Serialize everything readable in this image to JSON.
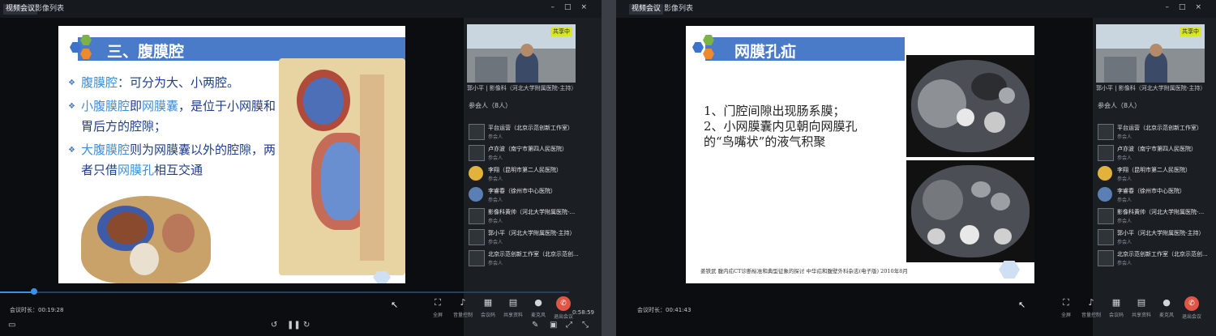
{
  "left_window": {
    "tabs": [
      "视频会议",
      "影像列表"
    ],
    "window_controls": [
      "–",
      "□",
      "×"
    ],
    "slide": {
      "title": "三、腹膜腔",
      "bullets": [
        [
          {
            "t": "腹膜腔",
            "hl": true
          },
          {
            "t": "：可分为大、小两腔。",
            "hl": false
          }
        ],
        [
          {
            "t": "小腹膜腔",
            "hl": true
          },
          {
            "t": "即",
            "hl": false
          },
          {
            "t": "网膜囊",
            "hl": true
          },
          {
            "t": "，是位于小网膜和胃后方的腔隙；",
            "hl": false
          }
        ],
        [
          {
            "t": "大腹膜腔",
            "hl": true
          },
          {
            "t": "则为网膜囊以外的腔隙，两者只借",
            "hl": false
          },
          {
            "t": "网膜孔",
            "hl": true
          },
          {
            "t": "相互交通",
            "hl": false
          }
        ]
      ]
    },
    "sidebar": {
      "share_badge": "共享中",
      "video_caption": "郭小平 | 影像科（河北大学附属医院-主持）",
      "participants_header": "参会人（8人）",
      "participants": [
        {
          "name": "平台运营（北京示范创新工作室）",
          "role": "参会人",
          "avatar": "generic"
        },
        {
          "name": "卢亦波（南宁市第四人民医院）",
          "role": "参会人",
          "avatar": "generic"
        },
        {
          "name": "李翔（昆明市第二人民医院）",
          "role": "参会人",
          "avatar": "cartoon"
        },
        {
          "name": "李睿春（徐州市中心医院）",
          "role": "参会人",
          "avatar": "photo"
        },
        {
          "name": "影像科黄帅（河北大学附属医院-...",
          "role": "参会人",
          "avatar": "generic"
        },
        {
          "name": "郭小平（河北大学附属医院-主持）",
          "role": "参会人",
          "avatar": "generic"
        },
        {
          "name": "北京示范创新工作室（北京示范创...",
          "role": "参会人",
          "avatar": "generic"
        }
      ]
    },
    "meeting_duration": "会议时长：00:19:28",
    "elapsed_time": "0:58:59",
    "progress": 0.06,
    "controls": [
      {
        "label": "全屏",
        "icon": "⛶"
      },
      {
        "label": "音量控制",
        "icon": "♪"
      },
      {
        "label": "会议码",
        "icon": "▦"
      },
      {
        "label": "共享资料",
        "icon": "▤"
      },
      {
        "label": "麦克风",
        "icon": "●"
      },
      {
        "label": "退出会议",
        "icon": "✆"
      }
    ]
  },
  "right_window": {
    "tabs": [
      "视频会议",
      "影像列表"
    ],
    "window_controls": [
      "–",
      "□",
      "×"
    ],
    "slide": {
      "title": "网膜孔疝",
      "points": [
        "1、门腔间隙出现肠系膜；",
        "2、小网膜囊内见朝向网膜孔",
        "的“鸟嘴状”的液气积聚"
      ],
      "citation": "姜铁武 腹内疝CT诊断标准和典型征象的探讨 中华疝和腹壁外科杂志(电子版) 2010年8月"
    },
    "sidebar": {
      "share_badge": "共享中",
      "video_caption": "郭小平 | 影像科（河北大学附属医院-主持）",
      "participants_header": "参会人（8人）",
      "participants": [
        {
          "name": "平台运营（北京示范创新工作室）",
          "role": "参会人",
          "avatar": "generic"
        },
        {
          "name": "卢亦波（南宁市第四人民医院）",
          "role": "参会人",
          "avatar": "generic"
        },
        {
          "name": "李翔（昆明市第二人民医院）",
          "role": "参会人",
          "avatar": "cartoon"
        },
        {
          "name": "李睿春（徐州市中心医院）",
          "role": "参会人",
          "avatar": "photo"
        },
        {
          "name": "影像科黄帅（河北大学附属医院-...",
          "role": "参会人",
          "avatar": "generic"
        },
        {
          "name": "郭小平（河北大学附属医院-主持）",
          "role": "参会人",
          "avatar": "generic"
        },
        {
          "name": "北京示范创新工作室（北京示范创...",
          "role": "参会人",
          "avatar": "generic"
        }
      ]
    },
    "meeting_duration": "会议时长：00:41:43",
    "controls": [
      {
        "label": "全屏",
        "icon": "⛶"
      },
      {
        "label": "音量控制",
        "icon": "♪"
      },
      {
        "label": "会议码",
        "icon": "▦"
      },
      {
        "label": "共享资料",
        "icon": "▤"
      },
      {
        "label": "麦克风",
        "icon": "●"
      },
      {
        "label": "退出会议",
        "icon": "✆"
      }
    ]
  },
  "colors": {
    "slide_blue": "#4a7bc8",
    "highlight": "#3f8ed6",
    "bullet_text": "#1f3e8a",
    "hex_green": "#7cb342",
    "hex_orange": "#ef8a2c",
    "hex_blue": "#3d74c9",
    "hangup": "#e05545"
  }
}
